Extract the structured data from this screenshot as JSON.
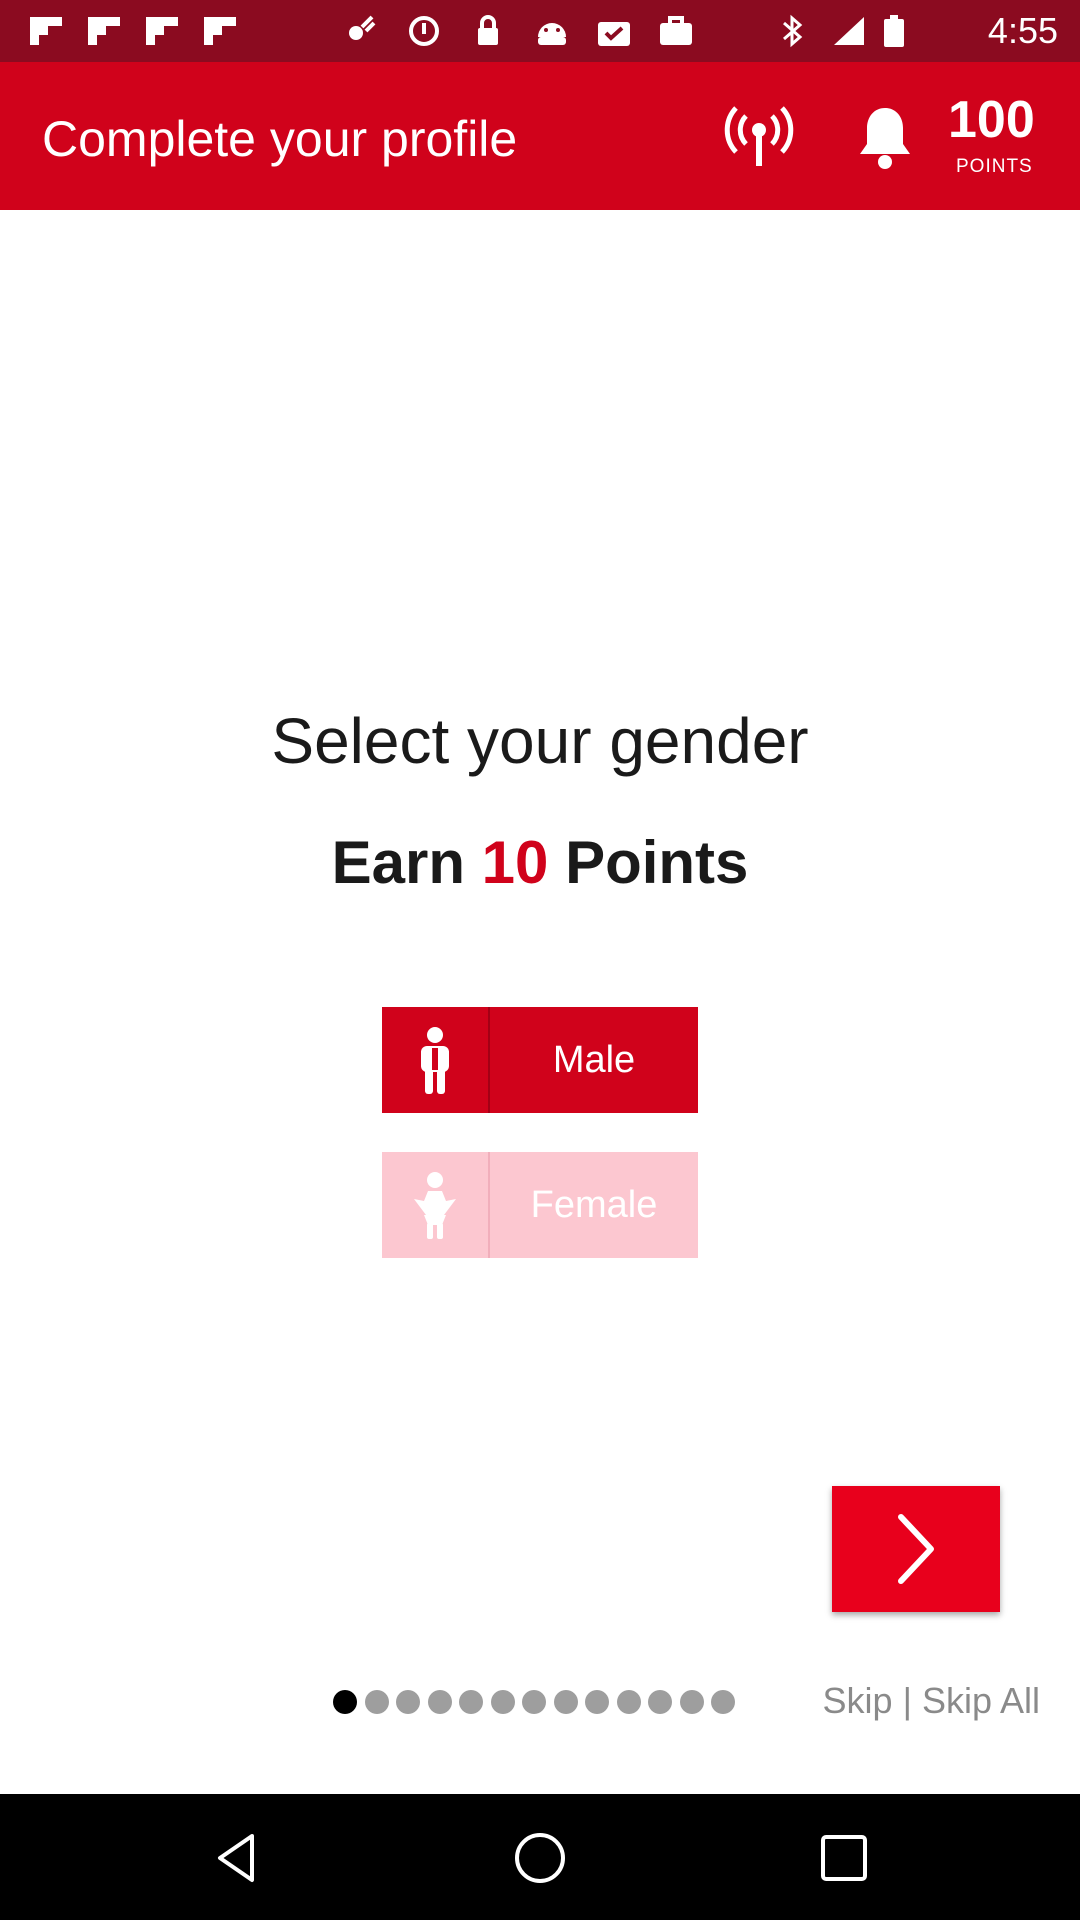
{
  "status_bar": {
    "time": "4:55",
    "icons": [
      "flipboard-icon",
      "flipboard-icon",
      "flipboard-icon",
      "flipboard-icon",
      "fake-gps-icon",
      "data-saver-icon",
      "lock-icon",
      "android-icon",
      "checkmark-bag-icon",
      "briefcase-icon",
      "bluetooth-icon",
      "signal-icon",
      "battery-icon"
    ]
  },
  "app_bar": {
    "title": "Complete your profile",
    "points_value": "100",
    "points_label": "POINTS"
  },
  "question": {
    "title": "Select your gender",
    "earn_prefix": "Earn",
    "earn_points": "10",
    "earn_suffix": "Points"
  },
  "options": {
    "male_label": "Male",
    "female_label": "Female"
  },
  "pager": {
    "total": 13,
    "active_index": 0
  },
  "skip": {
    "skip_label": "Skip",
    "separator": "|",
    "skip_all_label": "Skip All"
  },
  "colors": {
    "primary": "#d0021b",
    "status_bar": "#8b0b20",
    "female_option": "#fcc7d0"
  }
}
